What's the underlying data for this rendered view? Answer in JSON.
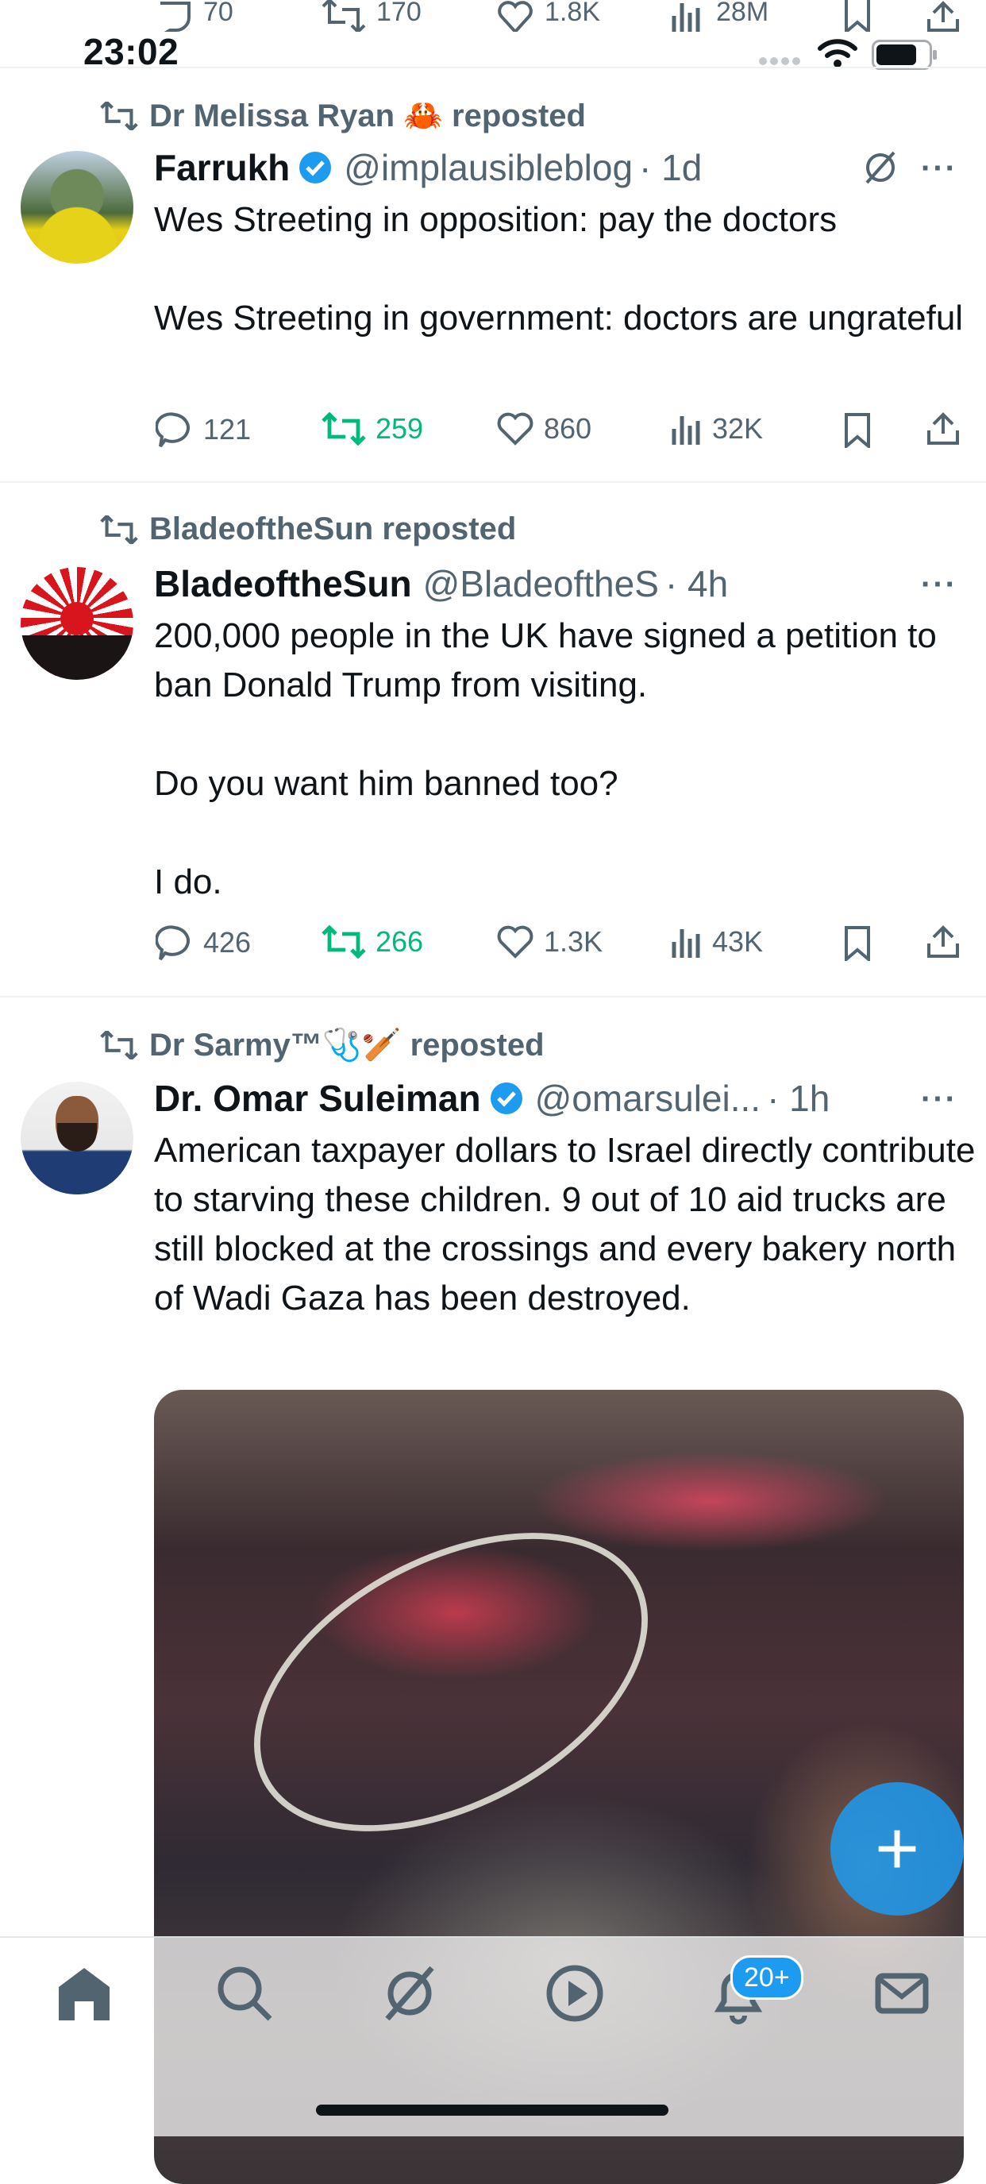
{
  "status_bar": {
    "time": "23:02"
  },
  "top_partial_actions": {
    "replies": "70",
    "reposts": "170",
    "likes": "1.8K",
    "views": "28M"
  },
  "tweets": [
    {
      "reposted_by": "Dr Melissa Ryan 🦀 reposted",
      "name": "Farrukh",
      "verified": true,
      "handle": "@implausibleblog",
      "time": "· 1d",
      "text": "Wes Streeting in opposition: pay the doctors\n\nWes Streeting in government: doctors are ungrateful",
      "replies": "121",
      "reposts": "259",
      "likes": "860",
      "views": "32K",
      "repost_active": true
    },
    {
      "reposted_by": "BladeoftheSun reposted",
      "name": "BladeoftheSun",
      "verified": false,
      "handle": "@BladeoftheS",
      "time": "· 4h",
      "text": "200,000 people in the UK have signed a petition to ban Donald Trump from visiting.\n\nDo you want him banned too?\n\nI do.",
      "replies": "426",
      "reposts": "266",
      "likes": "1.3K",
      "views": "43K",
      "repost_active": true
    },
    {
      "reposted_by": "Dr Sarmy™🩺🏏 reposted",
      "name": "Dr. Omar Suleiman",
      "verified": true,
      "handle": "@omarsulei...",
      "time": "· 1h",
      "text": "American taxpayer dollars to Israel directly contribute to starving these children. 9 out of 10 aid trucks are still blocked at the crossings and every bakery north of Wadi Gaza has been destroyed."
    }
  ],
  "fab": {
    "label": "+"
  },
  "tab_bar": {
    "notifications_badge": "20+"
  },
  "colors": {
    "accent": "#1d9bf0",
    "repost_green": "#00ba7c",
    "secondary_text": "#536471"
  }
}
